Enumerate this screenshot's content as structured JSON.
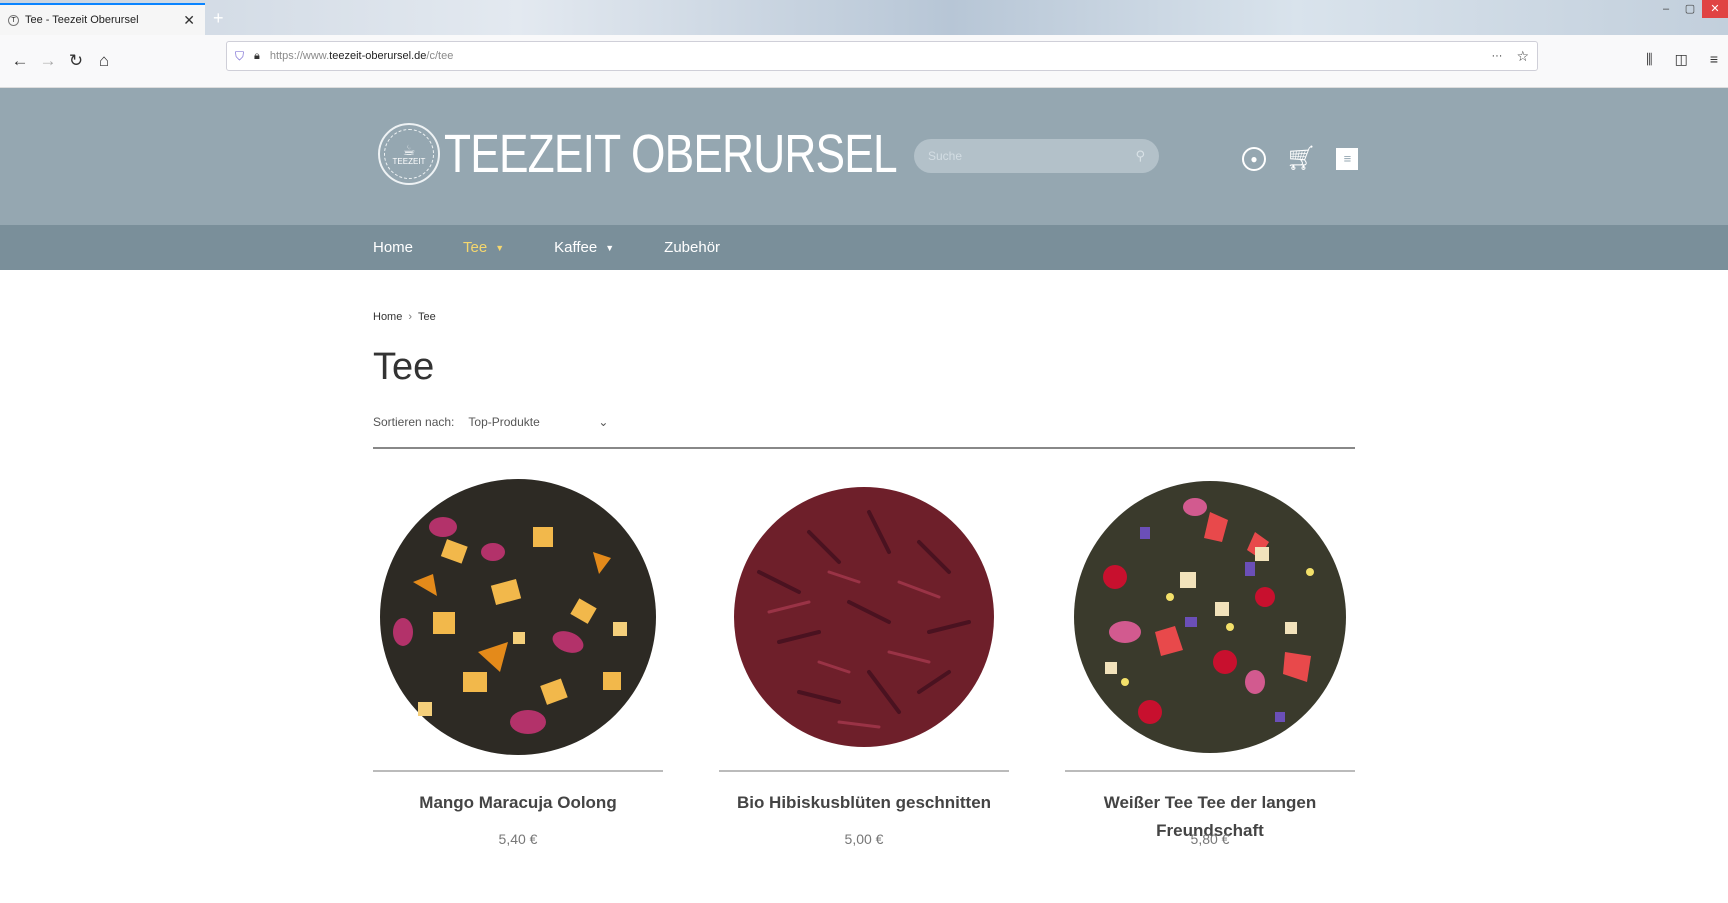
{
  "browser": {
    "tab_title": "Tee - Teezeit Oberursel",
    "new_tab": "+",
    "url_host": "https://www.",
    "url_domain": "teezeit-oberursel.de",
    "url_path": "/c/tee"
  },
  "site": {
    "logo_text": "TEEZEIT OBERURSEL",
    "logo_seal_text": "TEEZEIT",
    "search_placeholder": "Suche",
    "nav": [
      {
        "label": "Home"
      },
      {
        "label": "Tee"
      },
      {
        "label": "Kaffee"
      },
      {
        "label": "Zubehör"
      }
    ]
  },
  "breadcrumb": [
    "Home",
    "Tee"
  ],
  "page_title": "Tee",
  "sort": {
    "label": "Sortieren nach:",
    "selected": "Top-Produkte"
  },
  "products": [
    {
      "name": "Mango Maracuja Oolong",
      "price": "5,40 €"
    },
    {
      "name": "Bio Hibiskusblüten geschnitten",
      "price": "5,00 €"
    },
    {
      "name": "Weißer Tee Tee der langen Freundschaft",
      "price": "5,80 €"
    }
  ],
  "colors": {
    "header_bg": "#95a7b1",
    "nav_bg": "#7a8f9a",
    "nav_active": "#f5d76e"
  }
}
